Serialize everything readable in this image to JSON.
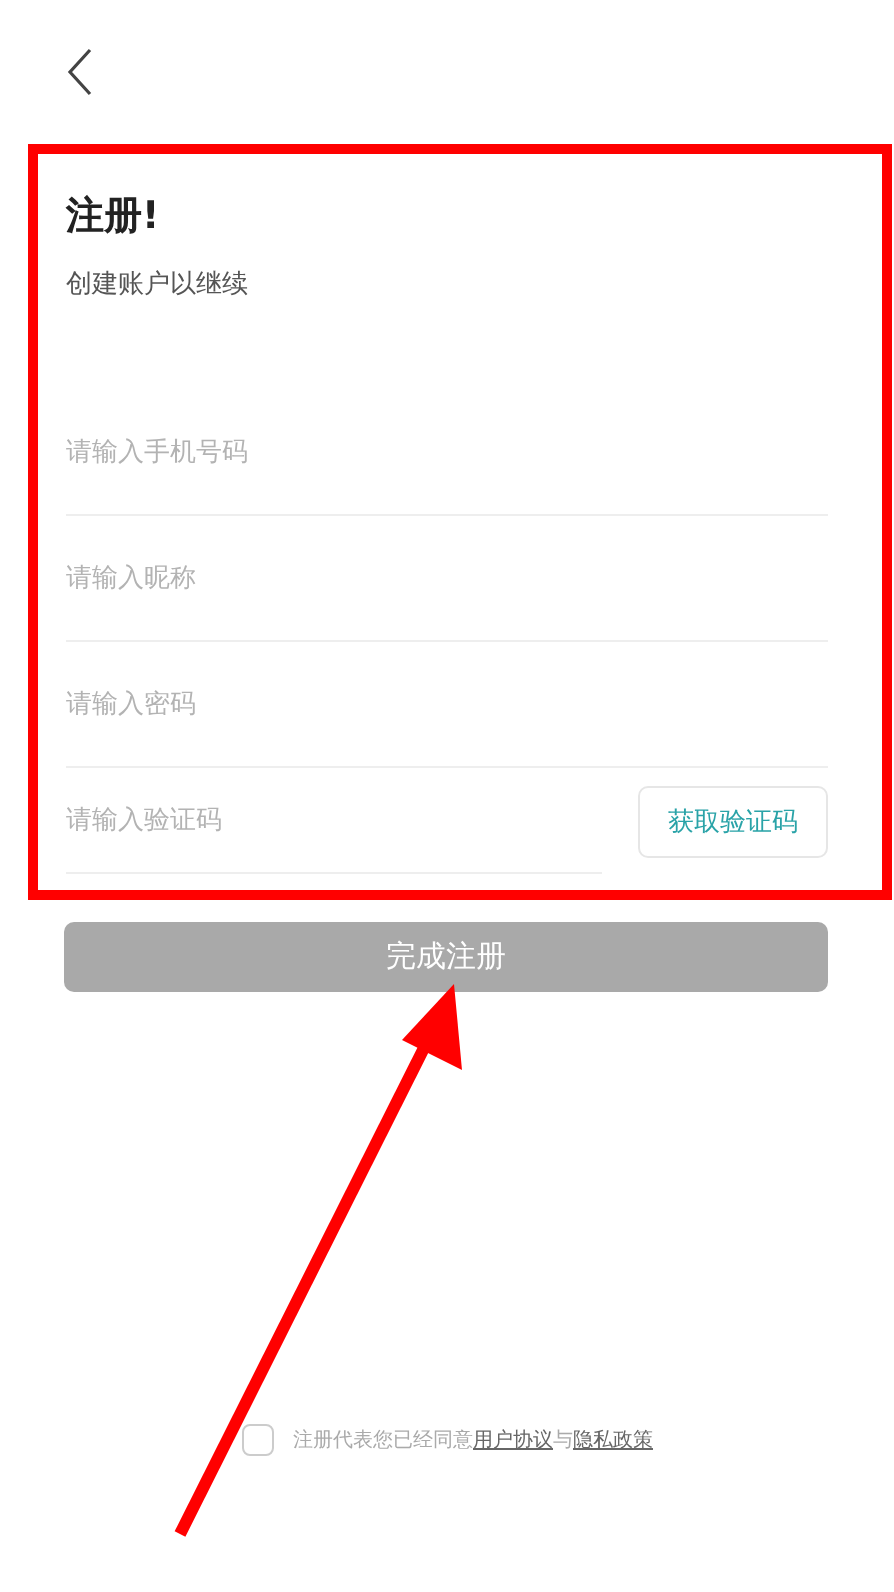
{
  "form": {
    "title": "注册!",
    "subtitle": "创建账户以继续",
    "fields": [
      {
        "kind": "text",
        "placeholder": "请输入手机号码"
      },
      {
        "kind": "text",
        "placeholder": "请输入昵称"
      },
      {
        "kind": "password",
        "placeholder": "请输入密码"
      },
      {
        "kind": "code",
        "placeholder": "请输入验证码",
        "button": "获取验证码"
      }
    ]
  },
  "submit": {
    "label": "完成注册",
    "disabled": true
  },
  "agreement": {
    "checked": false,
    "text": "注册代表您已经同意",
    "link_1": "用户协议",
    "joiner": "与",
    "link_2": "隐私政策"
  }
}
